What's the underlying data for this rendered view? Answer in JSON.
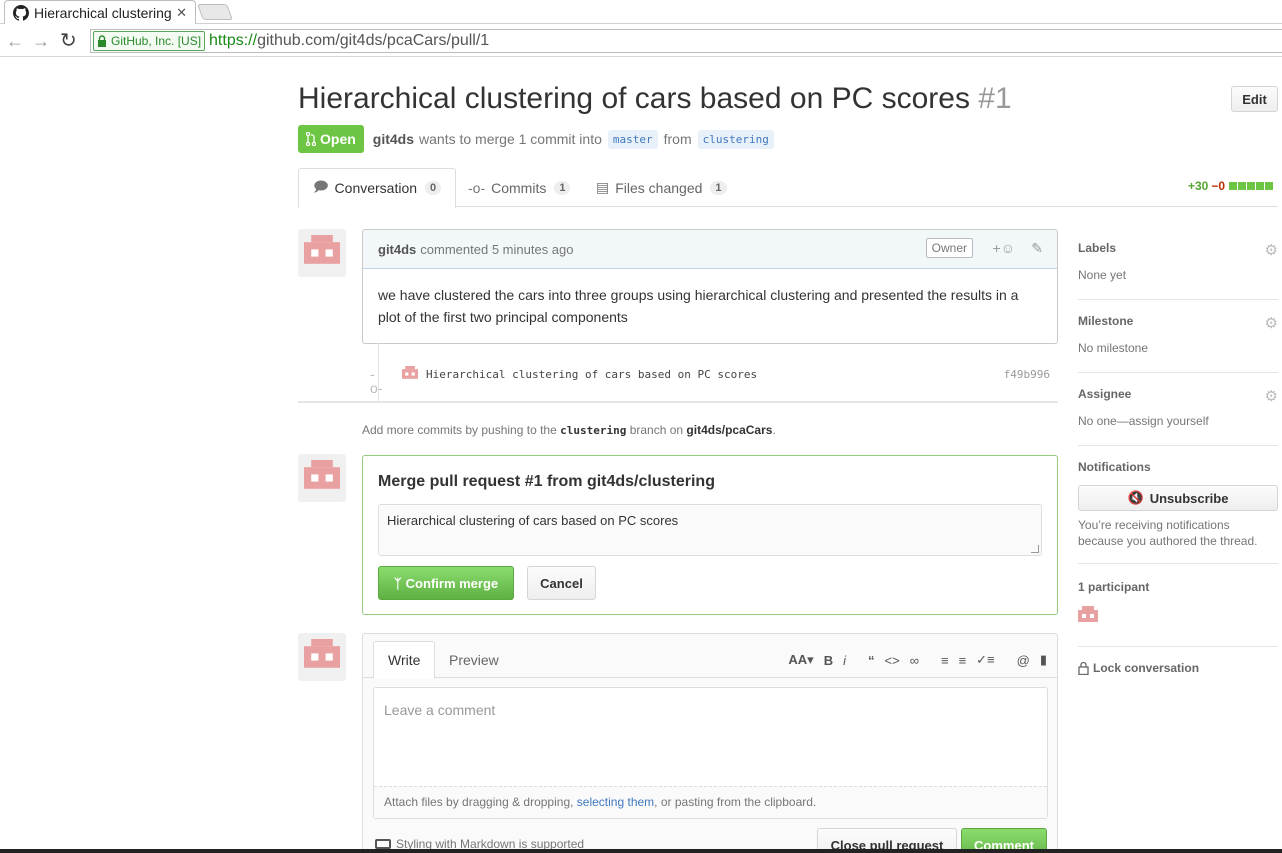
{
  "browser": {
    "tab_title": "Hierarchical clustering of cars based on PC scores",
    "tab_close": "✕",
    "ev_label": "GitHub, Inc. [US]",
    "url_scheme": "https://",
    "url_rest": "github.com/git4ds/pcaCars/pull/1"
  },
  "pr": {
    "title": "Hierarchical clustering of cars based on PC scores",
    "number": "#1",
    "edit_label": "Edit",
    "state": "Open",
    "author": "git4ds",
    "meta_text_1": "wants to merge 1 commit into",
    "base_branch": "master",
    "meta_text_2": "from",
    "head_branch": "clustering"
  },
  "tabs": [
    {
      "label": "Conversation",
      "count": "0"
    },
    {
      "label": "Commits",
      "count": "1"
    },
    {
      "label": "Files changed",
      "count": "1"
    }
  ],
  "diffstat": {
    "additions": "+30",
    "deletions": "−0"
  },
  "comment": {
    "author": "git4ds",
    "meta": "commented 5 minutes ago",
    "badge": "Owner",
    "body": "we have clustered the cars into three groups using hierarchical clustering and presented the results in a plot of the first two principal components"
  },
  "commit": {
    "message": "Hierarchical clustering of cars based on PC scores",
    "sha": "f49b996"
  },
  "push_hint": {
    "prefix": "Add more commits by pushing to the",
    "branch": "clustering",
    "middle": "branch on",
    "repo": "git4ds/pcaCars",
    "suffix": "."
  },
  "merge": {
    "title": "Merge pull request #1 from git4ds/clustering",
    "message": "Hierarchical clustering of cars based on PC scores",
    "confirm_label": "Confirm merge",
    "cancel_label": "Cancel"
  },
  "new_comment": {
    "write_tab": "Write",
    "preview_tab": "Preview",
    "placeholder": "Leave a comment",
    "attach_prefix": "Attach files by dragging & dropping,",
    "attach_link": "selecting them",
    "attach_suffix": ", or pasting from the clipboard.",
    "markdown_note": "Styling with Markdown is supported",
    "close_label": "Close pull request",
    "comment_label": "Comment"
  },
  "sidebar": {
    "labels_heading": "Labels",
    "labels_value": "None yet",
    "milestone_heading": "Milestone",
    "milestone_value": "No milestone",
    "assignee_heading": "Assignee",
    "assignee_value": "No one—assign yourself",
    "notifications_heading": "Notifications",
    "unsubscribe_label": "Unsubscribe",
    "notifications_reason": "You’re receiving notifications because you authored the thread.",
    "participants_heading": "1 participant",
    "lock_label": "Lock conversation"
  },
  "colors": {
    "open_green": "#6cc644",
    "merge_border": "#95c97e",
    "identicon": "#e8a0a0",
    "link": "#4078c0"
  }
}
